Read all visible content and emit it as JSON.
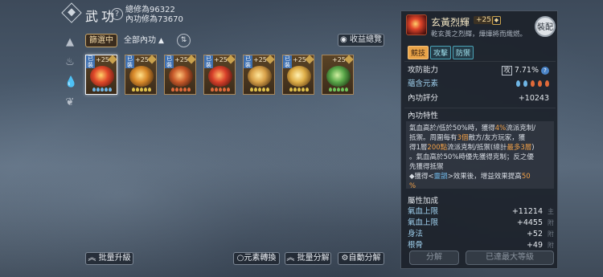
{
  "header": {
    "title": "武功",
    "total_cultivation": "總修為96322",
    "inner_cultivation": "內功修為73670"
  },
  "filters": {
    "filter_label": "篩選中",
    "sort_label": "全部內功",
    "preview_label": "收益總覽"
  },
  "cards": [
    {
      "tag": "已裝",
      "level": "+25",
      "art_colors": [
        "#ffd36a",
        "#e24a2a",
        "#6b1b13"
      ],
      "pips": [
        "#6fb6e6",
        "#6fb6e6",
        "#6fb6e6",
        "#6fb6e6",
        "#6fb6e6"
      ],
      "selected": true
    },
    {
      "tag": "已裝",
      "level": "+25",
      "art_colors": [
        "#ffe08a",
        "#d98a2a",
        "#5a3412"
      ],
      "pips": [
        "#e0c04a",
        "#e0c04a",
        "#e0c04a",
        "#e0c04a",
        "#e0c04a"
      ],
      "selected": false
    },
    {
      "tag": "已裝",
      "level": "+25",
      "art_colors": [
        "#ffc47a",
        "#c85a2a",
        "#4a2010"
      ],
      "pips": [
        "#e06a3a",
        "#e06a3a",
        "#e06a3a",
        "#e06a3a",
        "#e06a3a"
      ],
      "selected": false
    },
    {
      "tag": "已裝",
      "level": "+25",
      "art_colors": [
        "#ffb86a",
        "#d8402a",
        "#5a1810"
      ],
      "pips": [
        "#e06a3a",
        "#e06a3a",
        "#e06a3a",
        "#e06a3a",
        "#e06a3a"
      ],
      "selected": false
    },
    {
      "tag": "已裝",
      "level": "+25",
      "art_colors": [
        "#ffe69a",
        "#d9a24a",
        "#5a3a14"
      ],
      "pips": [
        "#e0c04a",
        "#e0c04a",
        "#e0c04a",
        "#e0c04a",
        "#e0c04a"
      ],
      "selected": false
    },
    {
      "tag": "已裝",
      "level": "+25",
      "art_colors": [
        "#fff0b0",
        "#e0b04a",
        "#6a4414"
      ],
      "pips": [
        "#e0c04a",
        "#e0c04a",
        "#e0c04a",
        "#e0c04a",
        "#e0c04a"
      ],
      "selected": false
    },
    {
      "tag": "",
      "level": "+25",
      "art_colors": [
        "#cfeea0",
        "#5aa84a",
        "#1f3a14"
      ],
      "pips": [
        "#6fc45a",
        "#6fc45a",
        "#6fc45a",
        "#6fc45a",
        "#6fc45a"
      ],
      "selected": false
    }
  ],
  "bottom_left": {
    "batch_upgrade": "批量升級",
    "element_convert": "元素轉換",
    "batch_decompose": "批量分解",
    "auto_decompose": "自動分解"
  },
  "panel": {
    "name": "玄黃烈輝",
    "level": "+25",
    "description": "乾玄黃之烈輝，燁燁將而熾燃。",
    "equip_label": "裝配",
    "tabs": [
      "競技",
      "攻擊",
      "防禦"
    ],
    "atk_def_label": "攻防能力",
    "atk_box": "攻",
    "atk_def_value": "7.71%",
    "element_label": "蘊含元素",
    "rating_label": "內功評分",
    "rating_value": "+10243",
    "trait_heading": "內功特性",
    "trait_lines": [
      {
        "parts": [
          {
            "t": "氣血高於/低於50%時，獲得"
          },
          {
            "t": "4%",
            "c": "o"
          },
          {
            "t": "流派克制/"
          }
        ]
      },
      {
        "parts": [
          {
            "t": "抵禦。周圍每有"
          },
          {
            "t": "3個",
            "c": "o"
          },
          {
            "t": "敵方/友方玩家，獲"
          }
        ]
      },
      {
        "parts": [
          {
            "t": "得1層"
          },
          {
            "t": "200點",
            "c": "o"
          },
          {
            "t": "流派克制/抵禦(總計"
          },
          {
            "t": "最多3層",
            "c": "o"
          },
          {
            "t": ")"
          }
        ]
      },
      {
        "parts": [
          {
            "t": "。氣血高於50%時優先獲得克制；反之優"
          }
        ]
      },
      {
        "parts": [
          {
            "t": "先獲得抵禦"
          }
        ]
      },
      {
        "parts": [
          {
            "t": "◆獲得<"
          },
          {
            "t": "靈韻",
            "c": "b"
          },
          {
            "t": ">效果後，增益效果提高"
          },
          {
            "t": "50",
            "c": "o"
          }
        ]
      },
      {
        "parts": [
          {
            "t": "%",
            "c": "o"
          }
        ]
      }
    ],
    "attr_heading": "屬性加成",
    "attributes": [
      {
        "label": "氣血上限",
        "value": "+11214",
        "mark": "主"
      },
      {
        "label": "氣血上限",
        "value": "+4455",
        "mark": "附"
      },
      {
        "label": "身法",
        "value": "+52",
        "mark": "附"
      },
      {
        "label": "根骨",
        "value": "+49",
        "mark": "附"
      }
    ],
    "decompose_label": "分解",
    "max_level_label": "已達最大等級"
  }
}
